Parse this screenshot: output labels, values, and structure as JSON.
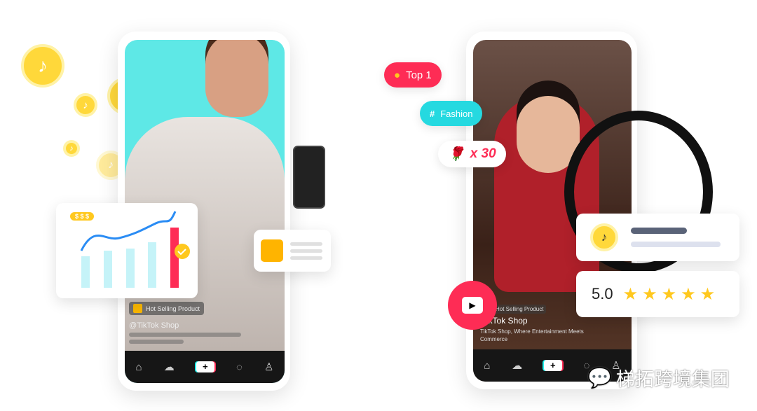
{
  "left_phone": {
    "badge": "Hot Selling Product",
    "handle": "@TikTok Shop",
    "chart_badge": "$ $ $"
  },
  "right_phone": {
    "badge": "Hot Selling Product",
    "title": "TikTok Shop",
    "subtitle": "TikTok Shop, Where Entertainment Meets Commerce"
  },
  "pills": {
    "top": "Top 1",
    "fashion": "Fashion",
    "gift_count": "x 30"
  },
  "rating": {
    "value": "5.0",
    "stars": 5
  },
  "watermark": "梯拓跨境集团",
  "colors": {
    "red": "#fe2c55",
    "teal": "#25d9e0",
    "yellow": "#ffd83a"
  }
}
